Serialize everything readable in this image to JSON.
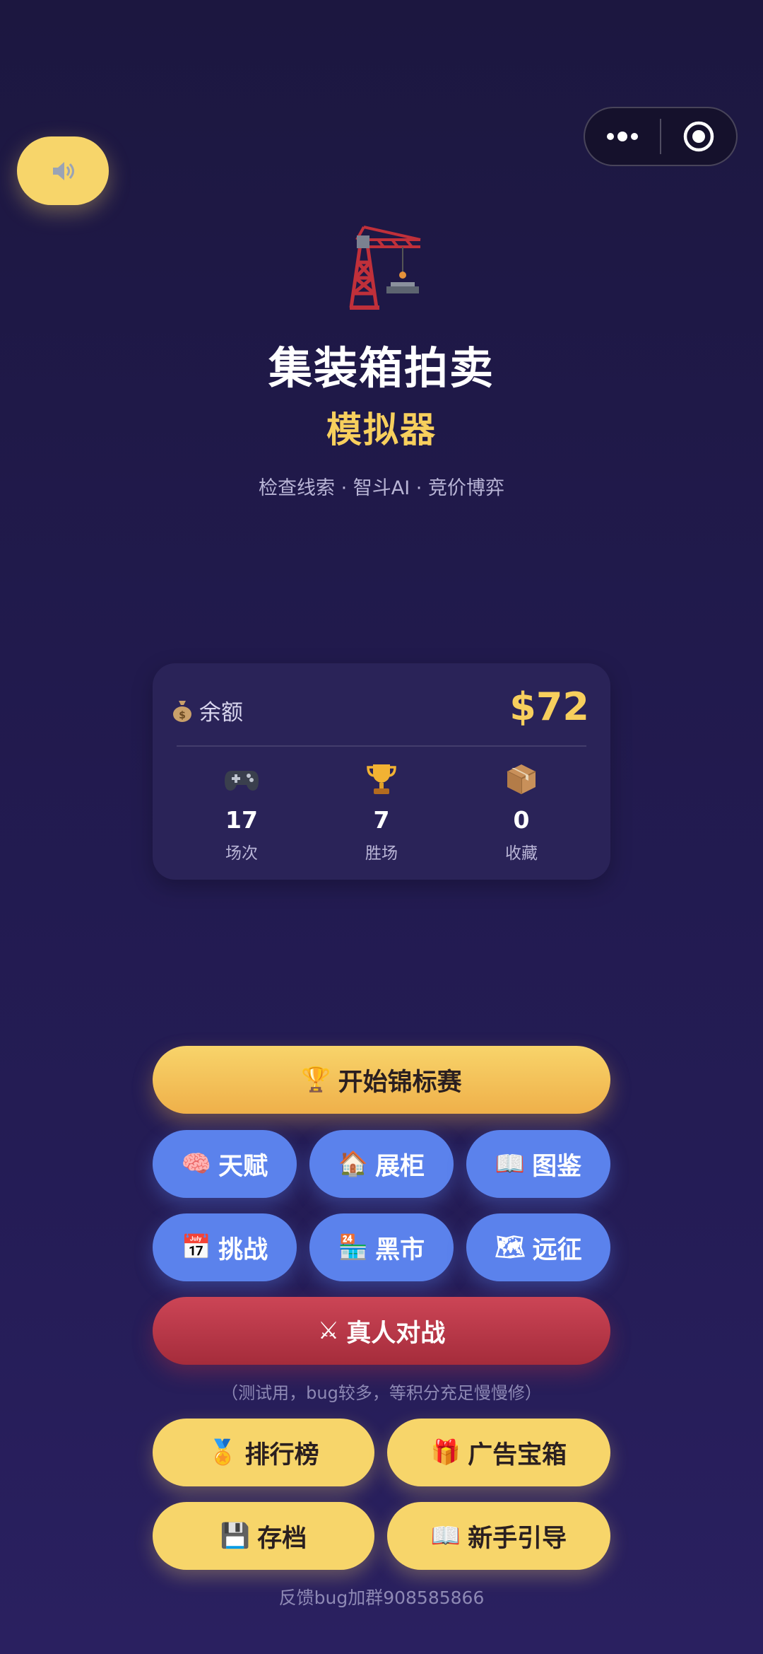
{
  "header": {
    "sound_icon": "speaker-icon",
    "capsule_more_icon": "more-dots-icon",
    "capsule_close_icon": "target-close-icon"
  },
  "hero": {
    "icon": "crane-icon",
    "title": "集装箱拍卖",
    "subtitle": "模拟器",
    "tagline": "检查线索 · 智斗AI · 竞价博弈"
  },
  "stats_card": {
    "balance_icon": "money-bag-icon",
    "balance_label": "余额",
    "balance_value": "$72",
    "stats": [
      {
        "icon": "gamepad-icon",
        "value": "17",
        "label": "场次"
      },
      {
        "icon": "trophy-icon",
        "value": "7",
        "label": "胜场"
      },
      {
        "icon": "package-icon",
        "value": "0",
        "label": "收藏"
      }
    ]
  },
  "buttons": {
    "tournament": {
      "emoji": "🏆",
      "label": "开始锦标赛"
    },
    "talent": {
      "emoji": "🧠",
      "label": "天赋"
    },
    "showcase": {
      "emoji": "🏠",
      "label": "展柜"
    },
    "catalog": {
      "emoji": "📖",
      "label": "图鉴"
    },
    "challenge": {
      "emoji": "📅",
      "label": "挑战"
    },
    "black_market": {
      "emoji": "🏪",
      "label": "黑市"
    },
    "expedition": {
      "emoji": "🗺",
      "label": "远征"
    },
    "pvp": {
      "emoji": "⚔",
      "label": "真人对战"
    },
    "leaderboard": {
      "emoji": "🏅",
      "label": "排行榜"
    },
    "ad_chest": {
      "emoji": "🎁",
      "label": "广告宝箱"
    },
    "save": {
      "emoji": "💾",
      "label": "存档"
    },
    "guide": {
      "emoji": "📖",
      "label": "新手引导"
    }
  },
  "pvp_note": "（测试用，bug较多，等积分充足慢慢修）",
  "footer": "反馈bug加群908585866",
  "colors": {
    "gold": "#f7cf5d",
    "blue": "#5b82ec",
    "red": "#b8384a",
    "background": "#211a4d"
  }
}
